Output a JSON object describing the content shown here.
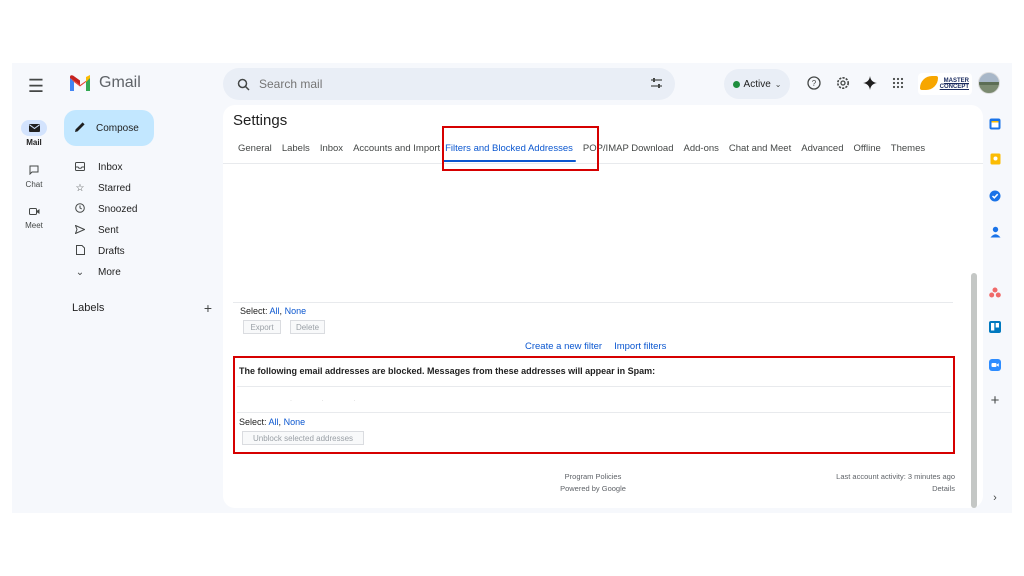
{
  "header": {
    "app_name": "Gmail",
    "search_placeholder": "Search mail",
    "status_label": "Active",
    "brand_text": "MASTER CONCEPT"
  },
  "rail": [
    {
      "label": "Mail",
      "active": true
    },
    {
      "label": "Chat",
      "active": false
    },
    {
      "label": "Meet",
      "active": false
    }
  ],
  "nav": {
    "compose": "Compose",
    "items": [
      "Inbox",
      "Starred",
      "Snoozed",
      "Sent",
      "Drafts",
      "More"
    ],
    "labels_heading": "Labels"
  },
  "settings": {
    "title": "Settings",
    "tabs": [
      "General",
      "Labels",
      "Inbox",
      "Accounts and Import",
      "Filters and Blocked Addresses",
      "POP/IMAP Download",
      "Add-ons",
      "Chat and Meet",
      "Advanced",
      "Offline",
      "Themes"
    ],
    "selected_tab": "Filters and Blocked Addresses"
  },
  "filters": {
    "select_prefix": "Select:",
    "select_all": "All",
    "select_none": "None",
    "export": "Export",
    "delete": "Delete",
    "create_filter": "Create a new filter",
    "import_filters": "Import filters"
  },
  "blocked": {
    "heading": "The following email addresses are blocked. Messages from these addresses will appear in Spam:",
    "select_prefix": "Select:",
    "select_all": "All",
    "select_none": "None",
    "unblock": "Unblock selected addresses"
  },
  "footer": {
    "program_policies": "Program Policies",
    "powered_by": "Powered by Google",
    "last_activity": "Last account activity: 3 minutes ago",
    "details": "Details"
  },
  "colors": {
    "highlight": "#d60000",
    "link": "#0b57d0",
    "compose_bg": "#c2e7ff"
  }
}
